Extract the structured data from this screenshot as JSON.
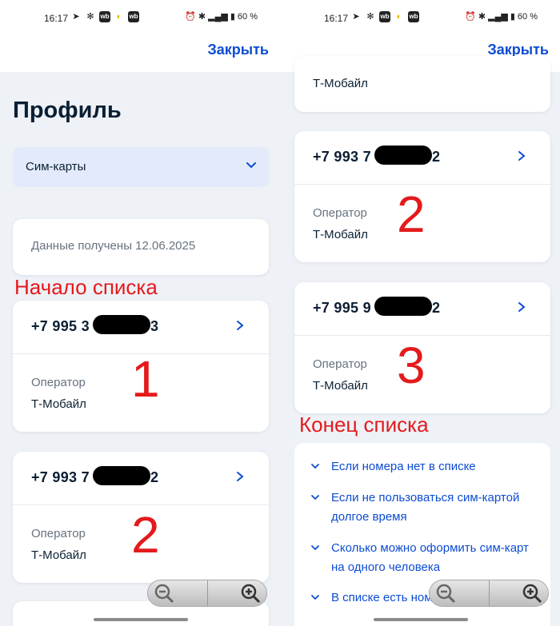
{
  "statusbar": {
    "time": "16:17",
    "battery": "60 %",
    "icons_left": [
      "telegram-icon",
      "settings-icon",
      "wb-icon",
      "moon-icon",
      "wb-icon"
    ],
    "icons_right": [
      "alarm-icon",
      "bluetooth-icon",
      "signal-icon",
      "battery-icon"
    ]
  },
  "header": {
    "close_label": "Закрыть"
  },
  "page": {
    "title": "Профиль"
  },
  "dropdown": {
    "label": "Сим-карты"
  },
  "info": {
    "text": "Данные получены 12.06.2025"
  },
  "annotations": {
    "list_start": "Начало списка",
    "list_end": "Конец списка",
    "n1": "1",
    "n2": "2",
    "n3": "3"
  },
  "sims": [
    {
      "number_start": "+7 995 3",
      "number_end": "3",
      "operator_label": "Оператор",
      "operator": "Т-Мобайл"
    },
    {
      "number_start": "+7 993 7",
      "number_end": "2",
      "operator_label": "Оператор",
      "operator": "Т-Мобайл"
    },
    {
      "number_start": "+7 995 9",
      "number_end": "2",
      "operator_label": "Оператор",
      "operator": "Т-Мобайл"
    }
  ],
  "right_top_operator": "Т-Мобайл",
  "faq": [
    "Если номера нет в списке",
    "Если не пользоваться сим-картой долгое время",
    "Сколько можно оформить сим-карт на одного человека",
    "В списке есть ном"
  ],
  "colors": {
    "accent": "#0d4cd3",
    "annotation": "#e41a1c",
    "background": "#eef1f6",
    "text": "#0b1f33",
    "muted": "#66727f"
  }
}
